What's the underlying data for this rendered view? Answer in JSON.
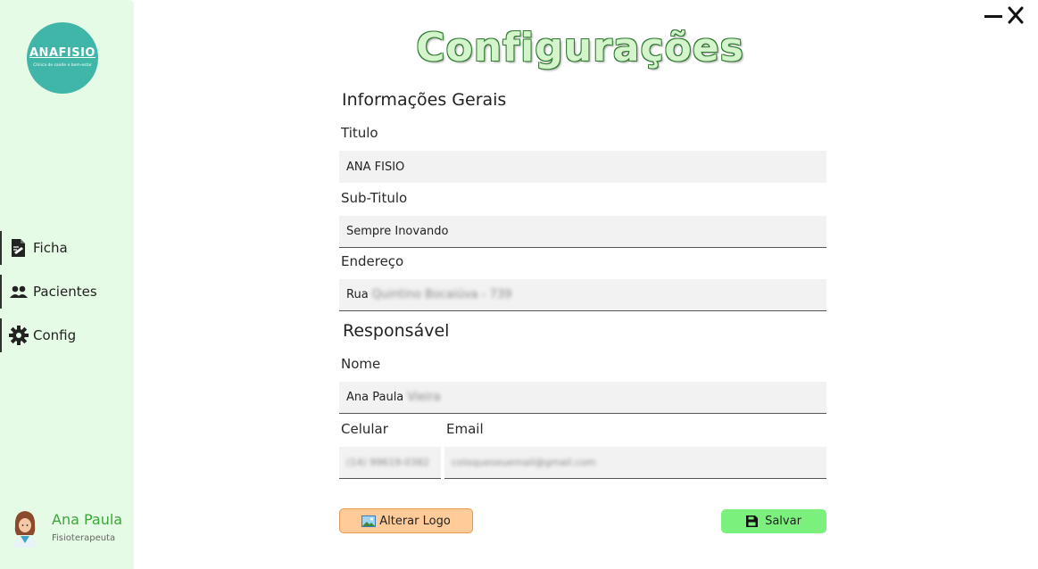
{
  "sidebar": {
    "logo": {
      "name": "ANAFISIO",
      "tagline": "Clínica de saúde e bem-estar"
    },
    "items": [
      {
        "label": "Ficha",
        "icon": "document-edit-icon"
      },
      {
        "label": "Pacientes",
        "icon": "users-icon"
      },
      {
        "label": "Config",
        "icon": "gear-icon"
      }
    ],
    "user": {
      "name": "Ana Paula",
      "role": "Fisioterapeuta"
    }
  },
  "page": {
    "title": "Configurações",
    "general_heading": "Informações Gerais",
    "responsible_heading": "Responsável"
  },
  "form": {
    "titulo_label": "Titulo",
    "titulo_value": "ANA FISIO",
    "subtitulo_label": "Sub-Titulo",
    "subtitulo_value": "Sempre Inovando",
    "endereco_label": "Endereço",
    "endereco_prefix": "Rua",
    "endereco_blurred": "Quintino Bocaiúva - 739",
    "nome_label": "Nome",
    "nome_prefix": "Ana Paula",
    "nome_blurred": "Vieira",
    "celular_label": "Celular",
    "celular_blurred": "(14) 99619-0382",
    "email_label": "Email",
    "email_blurred": "coloqueseuemail@gmail.com"
  },
  "buttons": {
    "alterar_logo": "Alterar Logo",
    "salvar": "Salvar"
  },
  "colors": {
    "sidebar_bg": "#e6fbe6",
    "logo_bg": "#3fb6a8",
    "user_name": "#3aa63a",
    "save_btn": "#7cf07c",
    "logo_btn": "#ffcc99"
  }
}
